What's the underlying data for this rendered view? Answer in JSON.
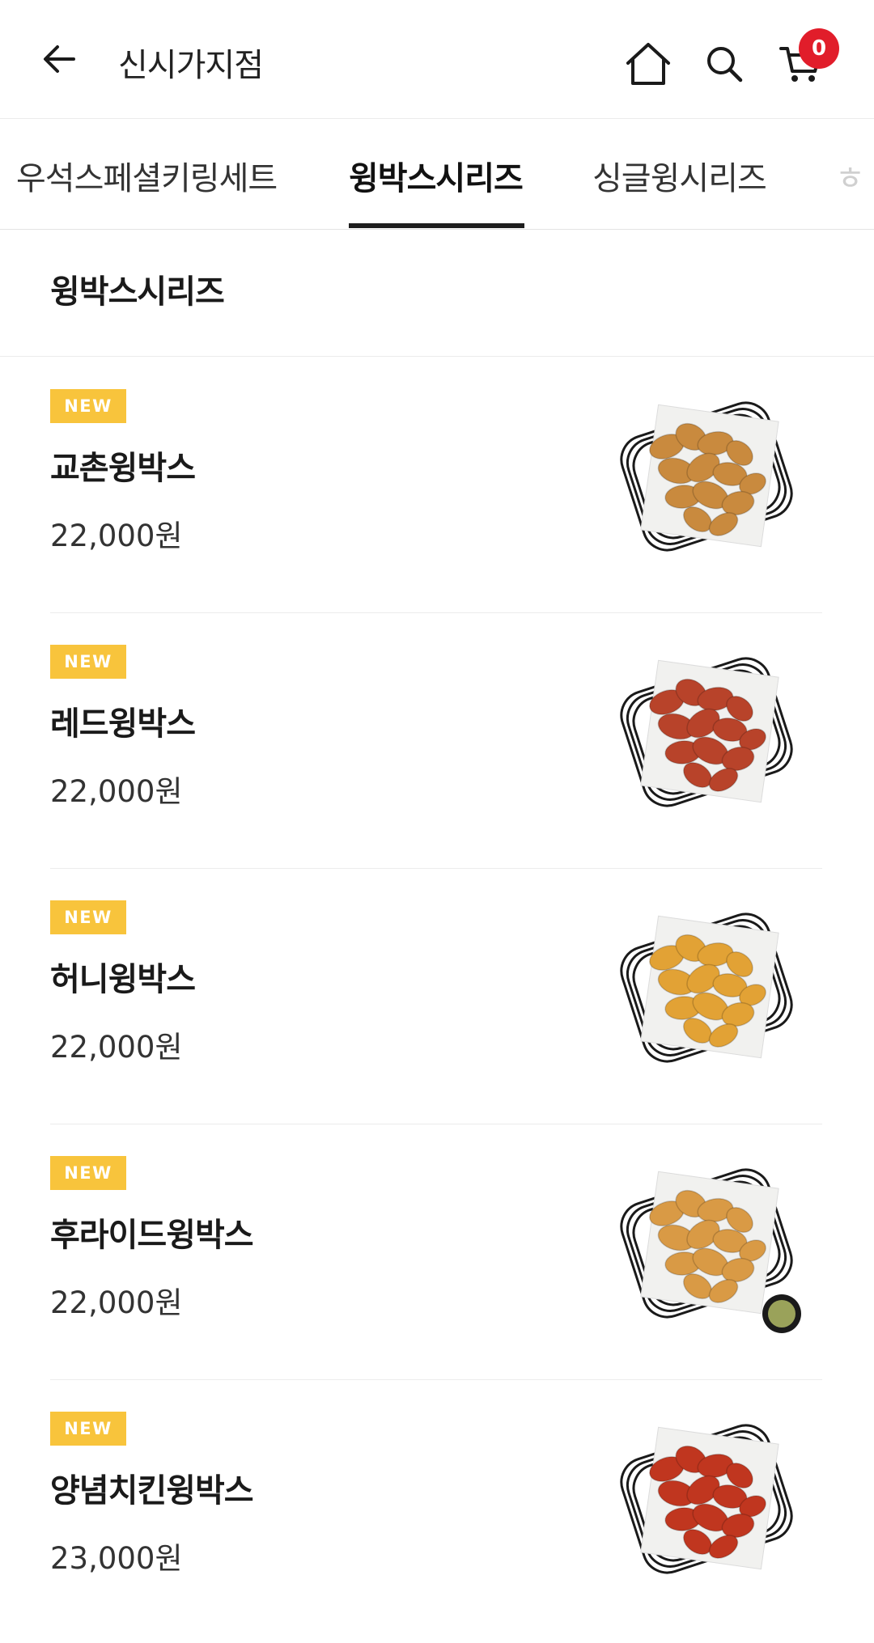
{
  "header": {
    "title": "신시가지점",
    "cart_count": "0",
    "back_icon": "arrow-left-icon",
    "home_icon": "home-icon",
    "search_icon": "search-icon",
    "cart_icon": "cart-icon"
  },
  "tabs": [
    {
      "label": "우석스페셜키링세트",
      "active": false
    },
    {
      "label": "윙박스시리즈",
      "active": true
    },
    {
      "label": "싱글윙시리즈",
      "active": false
    },
    {
      "label": "ㅎ",
      "active": false
    }
  ],
  "section": {
    "title": "윙박스시리즈"
  },
  "items": [
    {
      "badge": "NEW",
      "name": "교촌윙박스",
      "price": "22,000원",
      "chicken_color": "#c98a3e"
    },
    {
      "badge": "NEW",
      "name": "레드윙박스",
      "price": "22,000원",
      "chicken_color": "#b8432a"
    },
    {
      "badge": "NEW",
      "name": "허니윙박스",
      "price": "22,000원",
      "chicken_color": "#e2a235"
    },
    {
      "badge": "NEW",
      "name": "후라이드윙박스",
      "price": "22,000원",
      "chicken_color": "#d99a45"
    },
    {
      "badge": "NEW",
      "name": "양념치킨윙박스",
      "price": "23,000원",
      "chicken_color": "#c0361f"
    }
  ],
  "colors": {
    "badge": "#f8c43c",
    "cart_badge": "#e11d2a",
    "tab_indicator": "#1e1e1e"
  }
}
